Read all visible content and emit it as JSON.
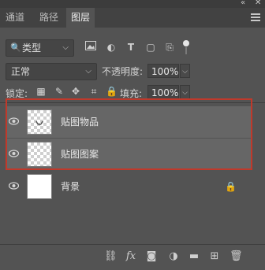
{
  "tabs": [
    {
      "label": "通道"
    },
    {
      "label": "路径"
    },
    {
      "label": "图层"
    }
  ],
  "filter": {
    "kind_label": "类型",
    "icons": [
      "image-filter-icon",
      "adjustment-filter-icon",
      "type-filter-icon",
      "shape-filter-icon",
      "smart-object-filter-icon"
    ]
  },
  "blend": {
    "mode": "正常",
    "opacity_label": "不透明度:",
    "opacity_value": "100%"
  },
  "locks": {
    "label": "锁定:",
    "fill_label": "填充:",
    "fill_value": "100%"
  },
  "layers": [
    {
      "name": "贴图物品",
      "visible": true,
      "selected": true
    },
    {
      "name": "贴图图案",
      "visible": true,
      "selected": true
    },
    {
      "name": "背景",
      "visible": true,
      "selected": false,
      "locked": true
    }
  ],
  "colors": {
    "panel_bg": "#535353",
    "selected_row": "#666666",
    "highlight_border": "#c0392b"
  },
  "bottom_icons": [
    "link-layers-icon",
    "fx-icon",
    "mask-icon",
    "adjustment-icon",
    "group-icon",
    "new-layer-icon",
    "delete-icon"
  ]
}
